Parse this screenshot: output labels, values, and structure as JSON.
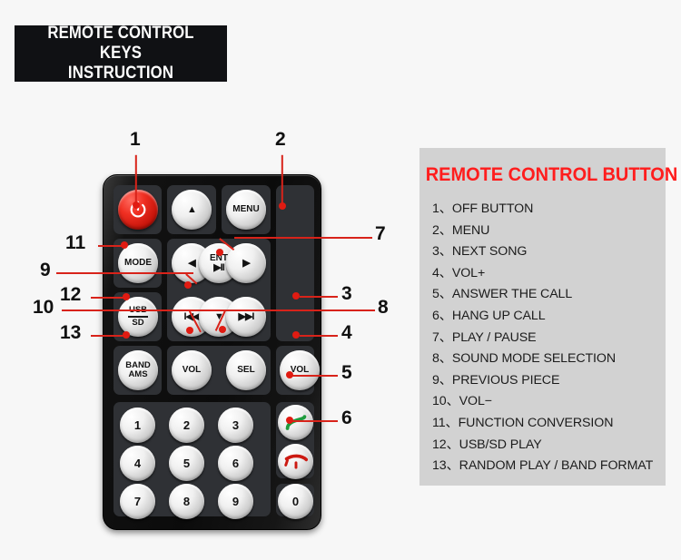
{
  "header": {
    "line1": "REMOTE CONTROL KEYS",
    "line2": "INSTRUCTION"
  },
  "legend": {
    "title": "REMOTE CONTROL BUTTON",
    "items": [
      "1、OFF BUTTON",
      "2、MENU",
      "3、NEXT SONG",
      "4、VOL+",
      "5、ANSWER THE CALL",
      "6、HANG UP CALL",
      "7、PLAY / PAUSE",
      "8、SOUND MODE SELECTION",
      "9、PREVIOUS PIECE",
      "10、VOL−",
      "11、FUNCTION CONVERSION",
      "12、USB/SD PLAY",
      "13、RANDOM PLAY / BAND FORMAT"
    ]
  },
  "callouts": {
    "c1": "1",
    "c2": "2",
    "c3": "3",
    "c4": "4",
    "c5": "5",
    "c6": "6",
    "c7": "7",
    "c8": "8",
    "c9": "9",
    "c10": "10",
    "c11": "11",
    "c12": "12",
    "c13": "13"
  },
  "remote": {
    "buttons": {
      "power": "⏻",
      "up": "▲",
      "menu": "MENU",
      "mode": "MODE",
      "left": "◀",
      "ent_top": "ENT",
      "ent_bottom": "▶II",
      "right": "▶",
      "usb": "USB",
      "sd": "SD",
      "prev": "I◀◀",
      "down": "▼",
      "next": "▶▶I",
      "band": "BAND",
      "ams": "AMS",
      "vol_down": "VOL",
      "sel": "SEL",
      "vol_up": "VOL",
      "key1": "1",
      "key2": "2",
      "key3": "3",
      "key4": "4",
      "key5": "5",
      "key6": "6",
      "key7": "7",
      "key8": "8",
      "key9": "9",
      "key0": "0",
      "answer": "answer-call-icon",
      "hangup": "hang-up-call-icon"
    }
  },
  "colors": {
    "background": "#f7f7f7",
    "banner": "#101114",
    "legend_panel": "#d2d2d2",
    "legend_title": "#ff1d1d",
    "leader_line": "#d8231a",
    "power_button": "#d4160b",
    "answer_green": "#1e9b3c",
    "hangup_red": "#cc1a12"
  }
}
